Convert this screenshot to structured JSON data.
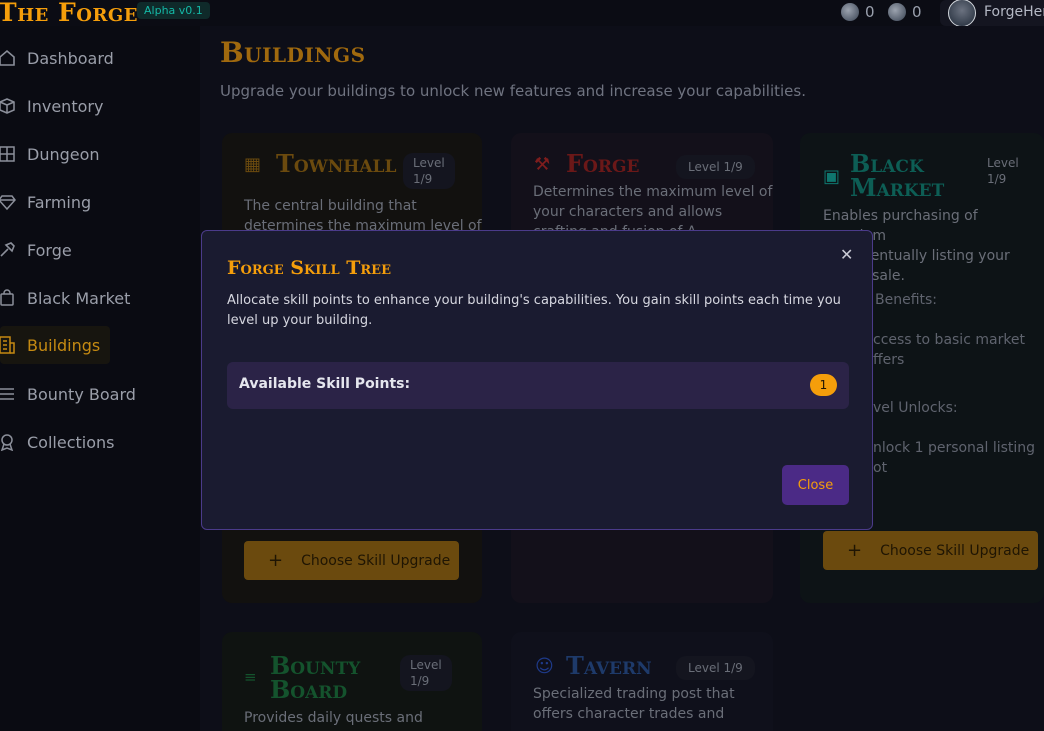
{
  "app": {
    "logo": "The Forge",
    "version_badge": "Alpha v0.1",
    "coins": [
      {
        "icon": "ore-coin-icon",
        "value": "0"
      },
      {
        "icon": "gem-coin-icon",
        "value": "0"
      }
    ],
    "username": "ForgeHer"
  },
  "sidebar": {
    "items": [
      {
        "label": "Dashboard",
        "icon": "home-icon"
      },
      {
        "label": "Inventory",
        "icon": "box-icon"
      },
      {
        "label": "Dungeon",
        "icon": "grid-icon"
      },
      {
        "label": "Farming",
        "icon": "gem-icon"
      },
      {
        "label": "Forge",
        "icon": "hammer-icon"
      },
      {
        "label": "Black Market",
        "icon": "bag-icon"
      },
      {
        "label": "Buildings",
        "icon": "building-icon",
        "active": true
      },
      {
        "label": "Bounty Board",
        "icon": "list-icon"
      },
      {
        "label": "Collections",
        "icon": "award-icon"
      }
    ]
  },
  "page": {
    "title": "Buildings",
    "subtitle": "Upgrade your buildings to unlock new features and increase your capabilities."
  },
  "buildings": {
    "townhall": {
      "name": "Townhall",
      "level_line1": "Level",
      "level_line2": "1/9",
      "desc_line1": "The central building that",
      "desc_line2": "determines the maximum level of",
      "upgrade_label": "Choose Skill Upgrade"
    },
    "forge": {
      "name": "Forge",
      "level": "Level 1/9",
      "desc_line1": "Determines the maximum level of",
      "desc_line2": "your characters and allows",
      "desc_line3": "crafting and fusion of A"
    },
    "black_market": {
      "name_line1": "Black",
      "name_line2": "Market",
      "level_line1": "Level",
      "level_line2": "1/9",
      "desc_line1": "Enables purchasing of premium",
      "desc_line2": "and eventually listing your",
      "desc_line3": "ms for sale.",
      "benefits_heading": "Benefits:",
      "benefit_line1": "ccess to basic market",
      "benefit_line2": "ffers",
      "unlocks_heading": "vel Unlocks:",
      "unlock_line1": "nlock 1 personal listing",
      "unlock_line2": "ot",
      "upgrade_label": "Choose Skill Upgrade"
    },
    "bounty_board": {
      "name_line1": "Bounty",
      "name_line2": "Board",
      "level_line1": "Level",
      "level_line2": "1/9",
      "desc_line1": "Provides daily quests and"
    },
    "tavern": {
      "name": "Tavern",
      "level": "Level 1/9",
      "desc_line1": "Specialized trading post that",
      "desc_line2": "offers character trades and"
    }
  },
  "modal": {
    "title": "Forge Skill Tree",
    "description": "Allocate skill points to enhance your building's capabilities. You gain skill points each time you level up your building.",
    "skill_points_label": "Available Skill Points:",
    "skill_points_value": "1",
    "close_label": "Close",
    "close_icon": "close-icon"
  },
  "colors": {
    "accent": "#f59e0b",
    "modal_bg": "#1a1b30",
    "modal_border": "#4b3b8a",
    "close_btn": "#4b2a86"
  }
}
